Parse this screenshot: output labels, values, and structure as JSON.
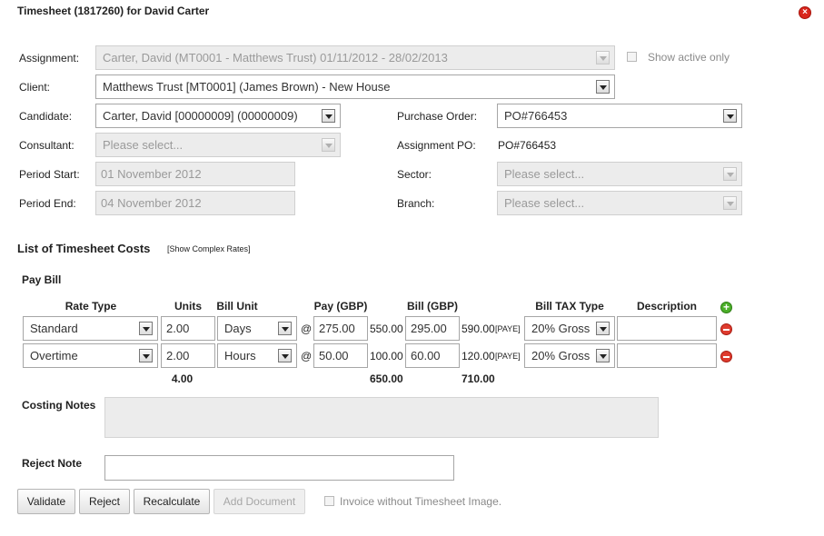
{
  "dialog": {
    "title": "Timesheet (1817260) for David Carter"
  },
  "form": {
    "assignment_label": "Assignment:",
    "assignment_value": "Carter, David (MT0001 - Matthews Trust) 01/11/2012 - 28/02/2013",
    "show_active_label": "Show active only",
    "client_label": "Client:",
    "client_value": "Matthews Trust [MT0001] (James Brown) - New House",
    "candidate_label": "Candidate:",
    "candidate_value": "Carter, David [00000009] (00000009)",
    "purchase_order_label": "Purchase Order:",
    "purchase_order_value": "PO#766453",
    "consultant_label": "Consultant:",
    "consultant_placeholder": "Please select...",
    "assignment_po_label": "Assignment PO:",
    "assignment_po_value": "PO#766453",
    "period_start_label": "Period Start:",
    "period_start_value": "01 November 2012",
    "sector_label": "Sector:",
    "sector_placeholder": "Please select...",
    "period_end_label": "Period End:",
    "period_end_value": "04 November 2012",
    "branch_label": "Branch:",
    "branch_placeholder": "Please select..."
  },
  "costs": {
    "heading": "List of Timesheet Costs",
    "complex_link": "[Show Complex Rates]",
    "pay_bill_label": "Pay Bill",
    "headers": {
      "rate_type": "Rate Type",
      "units": "Units",
      "bill_unit": "Bill Unit",
      "pay": "Pay (GBP)",
      "bill": "Bill (GBP)",
      "tax": "Bill TAX Type",
      "description": "Description"
    },
    "at": "@",
    "rows": [
      {
        "rate_type": "Standard",
        "units": "2.00",
        "bill_unit": "Days",
        "pay": "275.00",
        "pay_total": "550.00",
        "bill": "295.00",
        "bill_total": "590.00",
        "tag": "[PAYE]",
        "tax": "20% Gross"
      },
      {
        "rate_type": "Overtime",
        "units": "2.00",
        "bill_unit": "Hours",
        "pay": "50.00",
        "pay_total": "100.00",
        "bill": "60.00",
        "bill_total": "120.00",
        "tag": "[PAYE]",
        "tax": "20% Gross"
      }
    ],
    "totals": {
      "units": "4.00",
      "pay": "650.00",
      "bill": "710.00"
    }
  },
  "notes": {
    "costing_label": "Costing Notes",
    "reject_label": "Reject Note"
  },
  "actions": {
    "validate": "Validate",
    "reject": "Reject",
    "recalculate": "Recalculate",
    "add_document": "Add Document",
    "invoice_without_label": "Invoice without Timesheet Image."
  }
}
